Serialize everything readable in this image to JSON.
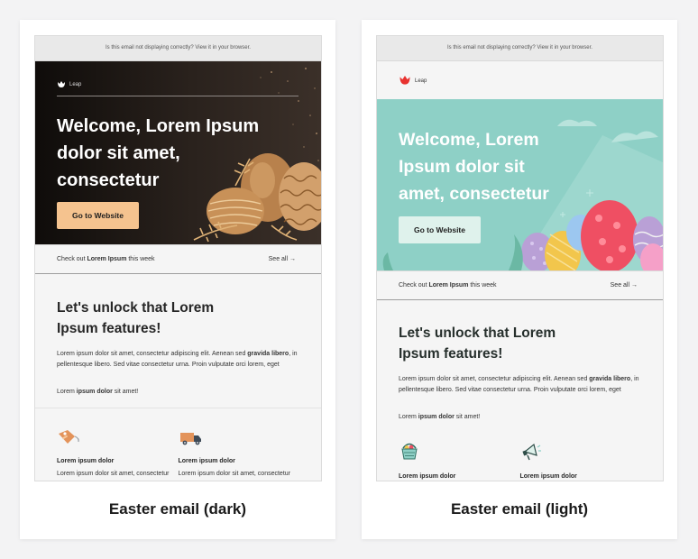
{
  "cards": [
    {
      "caption": "Easter email (dark)",
      "banner": "Is this email not displaying correctly? View it in your browser.",
      "brand": "Leap",
      "headline": "Welcome, Lorem Ipsum dolor sit amet, consectetur",
      "cta": "Go to Website",
      "check_prefix": "Check out ",
      "check_bold": "Lorem Ipsum",
      "check_suffix": " this week",
      "see_all": "See all →",
      "section_title": "Let's unlock that Lorem Ipsum features!",
      "para_a": "Lorem ipsum dolor sit amet, consectetur adipiscing elit. Aenean sed ",
      "para_bold": "gravida libero",
      "para_b": ", in pellentesque libero. Sed vitae consectetur urna. Proin vulputate orci lorem, eget",
      "para2_prefix": "Lorem ",
      "para2_bold": "ipsum dolor",
      "para2_suffix": " sit amet!",
      "features": [
        {
          "icon": "tag-icon",
          "title": "Lorem ipsum dolor",
          "desc": "Lorem ipsum dolor sit amet, consectetur adipiscing"
        },
        {
          "icon": "delivery-truck-icon",
          "title": "Lorem ipsum dolor",
          "desc": "Lorem ipsum dolor sit amet, consectetur adipiscing"
        }
      ]
    },
    {
      "caption": "Easter email (light)",
      "banner": "Is this email not displaying correctly? View it in your browser.",
      "brand": "Leap",
      "headline": "Welcome, Lorem Ipsum dolor sit amet, consectetur",
      "cta": "Go to Website",
      "check_prefix": "Check out ",
      "check_bold": "Lorem Ipsum",
      "check_suffix": " this week",
      "see_all": "See all →",
      "section_title": "Let's unlock that Lorem Ipsum features!",
      "para_a": "Lorem ipsum dolor sit amet, consectetur adipiscing elit. Aenean sed ",
      "para_bold": "gravida libero",
      "para_b": ", in pellentesque libero. Sed vitae consectetur urna. Proin vulputate orci lorem, eget",
      "para2_prefix": "Lorem ",
      "para2_bold": "ipsum dolor",
      "para2_suffix": " sit amet!",
      "features": [
        {
          "icon": "easter-basket-icon",
          "title": "Lorem ipsum dolor"
        },
        {
          "icon": "megaphone-icon",
          "title": "Lorem ipsum dolor"
        }
      ]
    }
  ],
  "colors": {
    "dark_cta": "#f5c38f",
    "light_hero": "#8ed0c6",
    "light_cta": "#dff2ec",
    "logo_red": "#e8322f"
  }
}
